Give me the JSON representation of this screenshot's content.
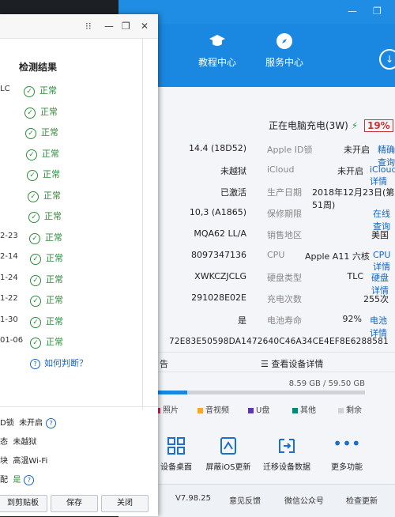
{
  "back_window": {
    "nav": [
      {
        "label": "教程中心",
        "icon": "graduation-cap-icon"
      },
      {
        "label": "服务中心",
        "icon": "compass-icon"
      }
    ],
    "charging_status": "正在电脑充电(3W)",
    "battery_percent": "19%",
    "info_rows": [
      {
        "left_value": "14.4 (18D52)",
        "label": "Apple ID锁",
        "value": "未开启",
        "link": "精确查询"
      },
      {
        "left_value": "未越狱",
        "label": "iCloud",
        "value": "未开启",
        "link": "iCloud详情"
      },
      {
        "left_value": "已激活",
        "label": "生产日期",
        "value": "2018年12月23日(第51周)",
        "link": ""
      },
      {
        "left_value": "10,3 (A1865)",
        "label": "保修期限",
        "value": "",
        "link": "在线查询"
      },
      {
        "left_value": "MQA62 LL/A",
        "label": "销售地区",
        "value": "美国",
        "link": ""
      },
      {
        "left_value": "8097347136",
        "label": "CPU",
        "value": "Apple A11 六核",
        "link": "CPU详情"
      },
      {
        "left_value": "XWKCZJCLG",
        "label": "硬盘类型",
        "value": "TLC",
        "link": "硬盘详情"
      },
      {
        "left_value": "291028E02E",
        "label": "充电次数",
        "value": "255次",
        "link": ""
      },
      {
        "left_value": "是",
        "label": "电池寿命",
        "value": "92%",
        "link": "电池详情"
      }
    ],
    "udid": "72E83E50598DA1472640C46A34CE4EF8E6288581",
    "report_fragment": "告",
    "view_details": "查看设备详情",
    "storage": "8.59 GB / 59.50 GB",
    "legend": [
      {
        "label": "照片",
        "color": "#d81b60"
      },
      {
        "label": "音视频",
        "color": "#f9a825"
      },
      {
        "label": "U盘",
        "color": "#5e35b1"
      },
      {
        "label": "其他",
        "color": "#00897b"
      },
      {
        "label": "剩余",
        "color": "#cfd3d8"
      }
    ],
    "tools": [
      {
        "label": "设备桌面",
        "icon": "grid-icon"
      },
      {
        "label": "屏蔽iOS更新",
        "icon": "shield-update-icon"
      },
      {
        "label": "迁移设备数据",
        "icon": "transfer-icon"
      },
      {
        "label": "更多功能",
        "icon": "more-icon"
      }
    ],
    "footer": {
      "version": "V7.98.25",
      "feedback": "意见反馈",
      "wechat": "微信公众号",
      "update": "检查更新"
    },
    "accent_color": "#1a87e0"
  },
  "front_window": {
    "controls": [
      "⁝⁝",
      "—",
      "❐",
      "✕"
    ],
    "result_header": "检测结果",
    "left_labels": [
      "LC",
      "",
      "",
      "",
      "",
      "",
      "",
      "2-23",
      "2-14",
      "1-24",
      "1-22",
      "1-30",
      "01-06"
    ],
    "results": [
      "正常",
      "正常",
      "正常",
      "正常",
      "正常",
      "正常",
      "正常",
      "正常",
      "正常",
      "正常",
      "正常",
      "正常",
      "正常"
    ],
    "how_to_judge": "如何判断？",
    "bottom_info": [
      {
        "label": "D锁",
        "value": "未开启",
        "help": true
      },
      {
        "label": "态",
        "value": "未越狱",
        "help": false
      },
      {
        "label": "块",
        "value": "高温Wi-Fi",
        "help": false
      },
      {
        "label": "配",
        "value": "是",
        "help": true
      }
    ],
    "buttons": [
      "到剪贴板",
      "保存",
      "关闭"
    ]
  }
}
